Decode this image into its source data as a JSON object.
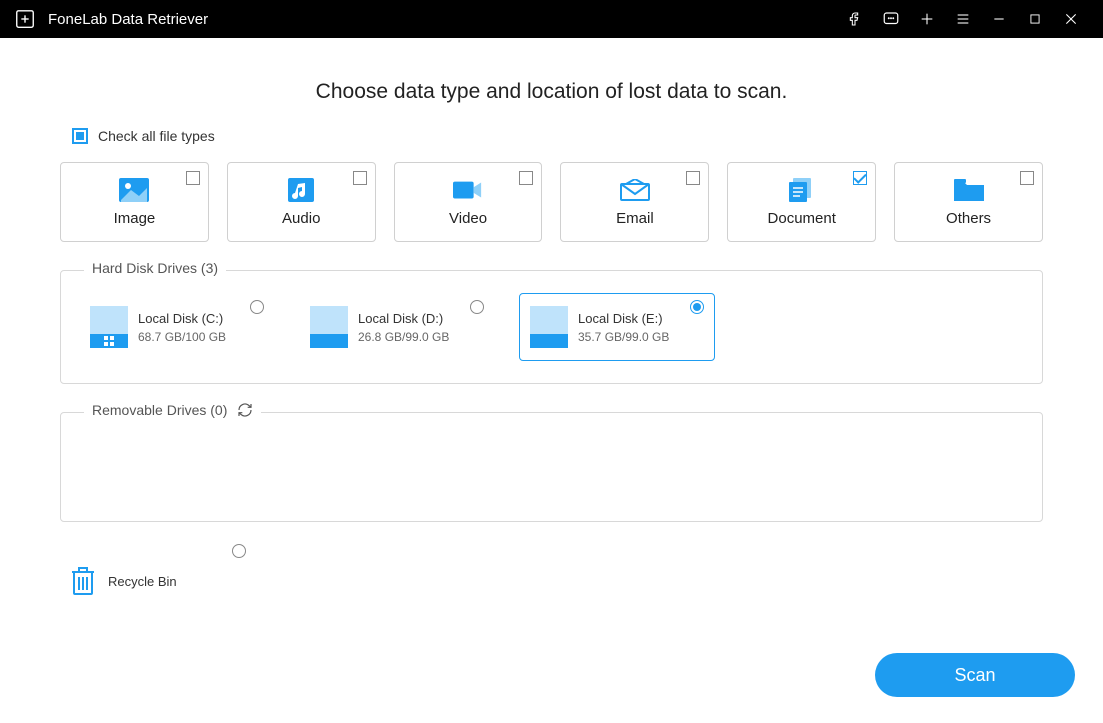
{
  "titlebar": {
    "app_name": "FoneLab Data Retriever"
  },
  "heading": "Choose data type and location of lost data to scan.",
  "check_all_label": "Check all file types",
  "check_all_state": "indeterminate",
  "types": [
    {
      "key": "image",
      "label": "Image",
      "checked": false
    },
    {
      "key": "audio",
      "label": "Audio",
      "checked": false
    },
    {
      "key": "video",
      "label": "Video",
      "checked": false
    },
    {
      "key": "email",
      "label": "Email",
      "checked": false
    },
    {
      "key": "document",
      "label": "Document",
      "checked": true
    },
    {
      "key": "others",
      "label": "Others",
      "checked": false
    }
  ],
  "hard_disk": {
    "title": "Hard Disk Drives (3)",
    "drives": [
      {
        "name": "Local Disk (C:)",
        "size": "68.7 GB/100 GB",
        "selected": false,
        "os": true
      },
      {
        "name": "Local Disk (D:)",
        "size": "26.8 GB/99.0 GB",
        "selected": false,
        "os": false
      },
      {
        "name": "Local Disk (E:)",
        "size": "35.7 GB/99.0 GB",
        "selected": true,
        "os": false
      }
    ]
  },
  "removable": {
    "title": "Removable Drives (0)"
  },
  "recycle": {
    "label": "Recycle Bin",
    "selected": false
  },
  "scan_label": "Scan"
}
